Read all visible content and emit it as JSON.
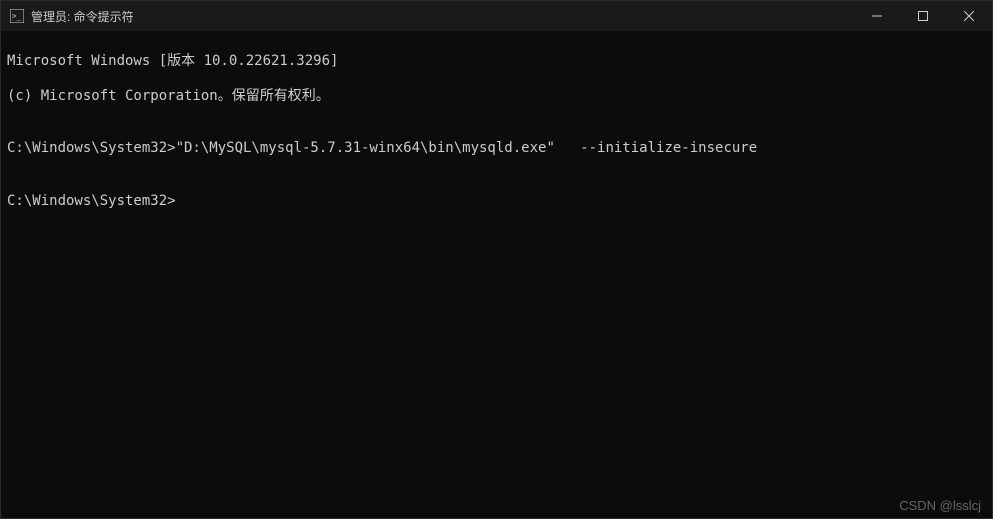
{
  "titlebar": {
    "title": "管理员: 命令提示符"
  },
  "terminal": {
    "line1": "Microsoft Windows [版本 10.0.22621.3296]",
    "line2": "(c) Microsoft Corporation。保留所有权利。",
    "blank1": "",
    "line3": "C:\\Windows\\System32>\"D:\\MySQL\\mysql-5.7.31-winx64\\bin\\mysqld.exe\"   --initialize-insecure",
    "blank2": "",
    "prompt": "C:\\Windows\\System32>"
  },
  "watermark": "CSDN @lsslcj"
}
